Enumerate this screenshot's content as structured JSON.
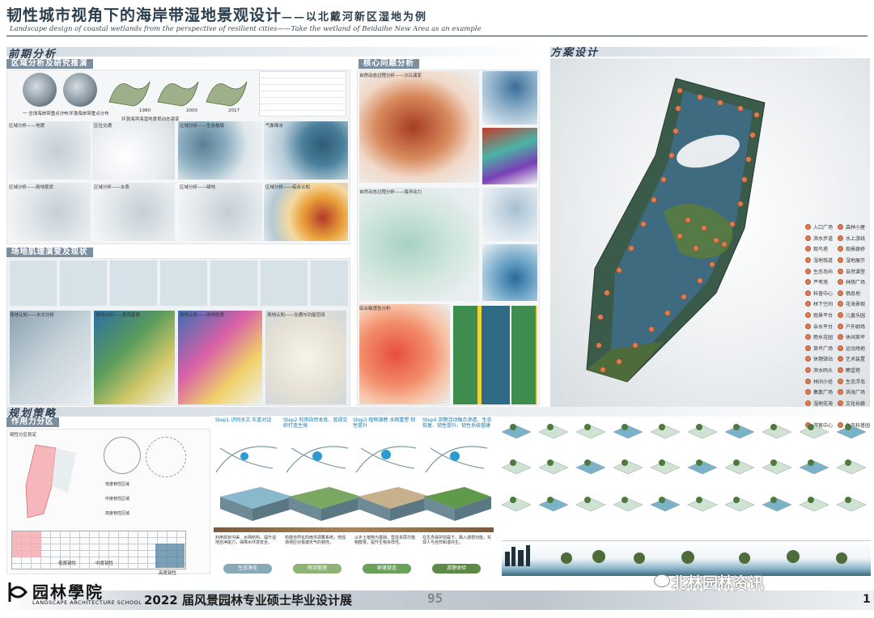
{
  "header": {
    "title_main": "韧性城市视角下的海岸带湿地景观设计",
    "title_sub": "——以北戴河新区湿地为例",
    "subtitle_en": "Landscape design of coastal wetlands from the perspective of resilient cities——Take the wetland of Beidaihe New Area as an example"
  },
  "sections": {
    "pre_analysis": "前期分析",
    "scheme": "方案设计",
    "planning": "规划策略"
  },
  "subsections": {
    "region": "区域分析及研究推演",
    "core": "核心问题分析",
    "texture": "场地肌理演变及现状",
    "zoning": "作用力分区"
  },
  "region_panel": {
    "globe_caption_1": "一 全球海岸带重点分布",
    "globe_caption_2": "一 环渤海岸带重点分布",
    "years": [
      "1980",
      "2000",
      "2017"
    ],
    "evolution_caption": "环渤海滨海湿地景观动态演变",
    "maps": [
      {
        "cn": "区域分析——地貌",
        "en": "Regional analysis——landform"
      },
      {
        "cn": "区位交通",
        "en": "Location analysis"
      },
      {
        "cn": "区域分析——生态格局",
        "en": "Regional analysis——ecological pattern"
      },
      {
        "cn": "气象降水",
        "en": "Meteorological precipitation"
      },
      {
        "cn": "区域分析——用地现状",
        "en": "Regional analysis——land use"
      },
      {
        "cn": "区域分析——水系",
        "en": "Regional analysis——water system"
      },
      {
        "cn": "区域分析——绿地",
        "en": "Regional analysis——green land"
      },
      {
        "cn": "区域分析——综合认知",
        "en": "Regional analysis——integrated cognition"
      }
    ]
  },
  "core_panel": {
    "captions": [
      "自然动态过程分析——沙丘演变",
      "自然动态过程分析——海洋动力",
      "综合敏感性分析"
    ]
  },
  "texture_panel": {
    "captions": [
      "场地认知——水文分析",
      "场地认知——景观基质",
      "场地认知——用地性质",
      "场地认知——交通与功能空间"
    ]
  },
  "zoning_panel": {
    "label": "韧性分区划定",
    "legend_low": "低度韧性",
    "legend_mid": "中度韧性",
    "legend_high": "高度韧性",
    "notes": [
      "低度韧性区域",
      "中度韧性区域",
      "高度韧性区域"
    ]
  },
  "strategy_steps": [
    {
      "title": "Step1 识别水文 灰蓝对话",
      "stage": "生态净化",
      "desc": "利用现状沟渠、水网结构，提升湿地自净能力，保障水环境安全。"
    },
    {
      "title": "Step2 利用自然本底、蓝绿交织打造生境",
      "stage": "雨洪管理",
      "desc": "构建自然化的雨洪调蓄系统，增强场地应对极端天气的韧性。"
    },
    {
      "title": "Step3 植物演替 水网重塑 韧性提升",
      "stage": "群落营造",
      "desc": "以乡土植物为基础，营造多层次植物群落，提升生物多样性。"
    },
    {
      "title": "Step4 游憩活动融合渗透，生态恢复、韧性提升、韧性系统营建",
      "stage": "游憩体验",
      "desc": "在生态保护前提下，融入游憩功能，实现人与自然和谐共生。"
    }
  ],
  "legend": {
    "left": [
      "入口广场",
      "滨水步道",
      "观鸟塔",
      "湿地栈道",
      "生态岛屿",
      "芦苇荡",
      "科普中心",
      "林下空间",
      "观景平台",
      "亲水平台",
      "雨水花园",
      "草坪广场",
      "休憩驿站",
      "滨水码头",
      "林间小径",
      "集散广场",
      "湿地花海",
      "生态停车场",
      "游客中心"
    ],
    "right": [
      "森林小屋",
      "水上游线",
      "观景廊桥",
      "湿地展示",
      "自然课堂",
      "林荫广场",
      "栖息地",
      "花海景观",
      "儿童乐园",
      "户外剧场",
      "休闲草坪",
      "运动场地",
      "艺术装置",
      "瞭望塔",
      "生态浮岛",
      "滨海广场",
      "文化长廊",
      "亲子活动区",
      "生态科普园"
    ]
  },
  "footer": {
    "logo_cn": "园林學院",
    "logo_en": "LANDSCAPE ARCHITECTURE SCHOOL",
    "exhibition": "2022 届风景园林专业硕士毕业设计展",
    "page": "95",
    "edge_num": "1",
    "wechat": "北林园林资讯"
  },
  "colors": {
    "accent": "#2b3e4e",
    "marker": "#e07a4f",
    "water": "#3b6a80",
    "green": "#4e6b3a"
  }
}
